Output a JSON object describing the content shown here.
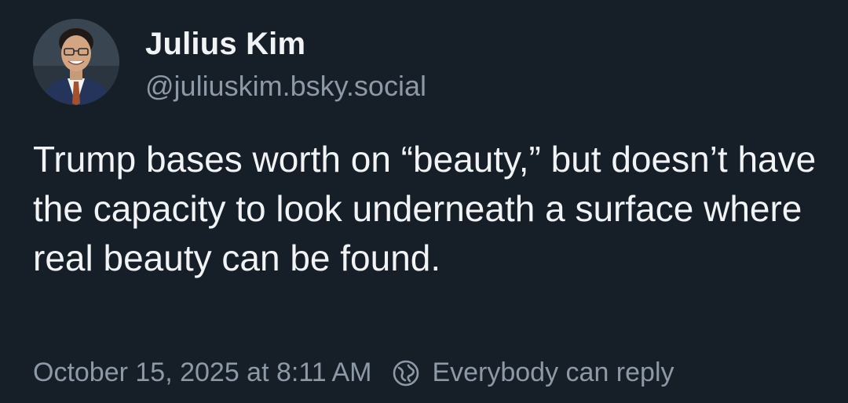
{
  "post": {
    "author": {
      "display_name": "Julius Kim",
      "handle": "@juliuskim.bsky.social",
      "avatar_icon": "profile-photo"
    },
    "text": "Trump bases worth on “beauty,” but doesn’t have the capacity to look underneath a surface where real beauty can be found.",
    "timestamp": "October 15, 2025 at 8:11 AM",
    "reply_setting": {
      "icon": "globe-icon",
      "label": "Everybody can reply"
    }
  },
  "colors": {
    "background": "#161e27",
    "text_primary": "#f1f3f5",
    "text_secondary": "#8d99a6"
  }
}
